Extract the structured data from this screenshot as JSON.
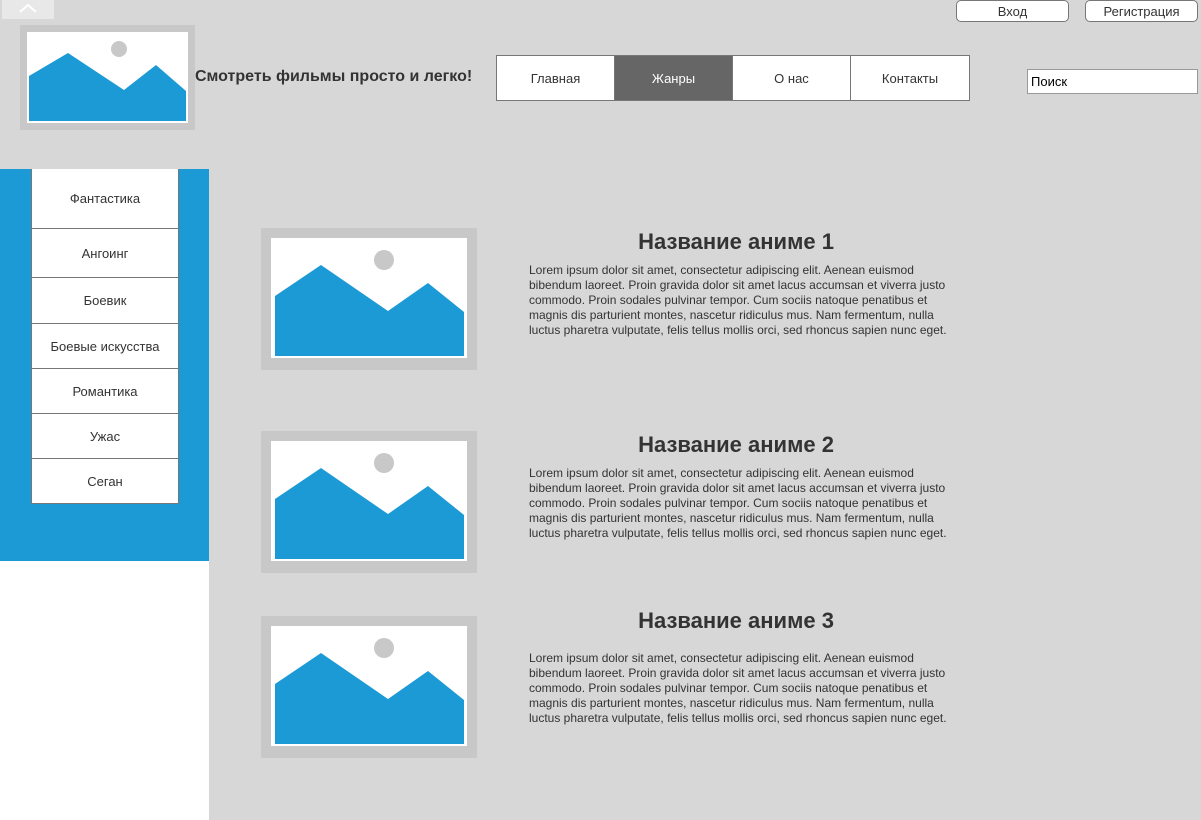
{
  "header": {
    "tagline": "Смотреть фильмы просто и легко!",
    "login_label": "Вход",
    "register_label": "Регистрация",
    "search_placeholder": "Поиск"
  },
  "nav": {
    "items": [
      {
        "label": "Главная",
        "active": false
      },
      {
        "label": "Жанры",
        "active": true
      },
      {
        "label": "О нас",
        "active": false
      },
      {
        "label": "Контакты",
        "active": false
      }
    ]
  },
  "genres": [
    "Фантастика",
    "Ангоинг",
    "Боевик",
    "Боевые искусства",
    "Романтика",
    "Ужас",
    "Сеган"
  ],
  "cards": [
    {
      "title": "Название аниме 1",
      "description": "Lorem ipsum dolor sit amet, consectetur adipiscing elit. Aenean euismod bibendum laoreet. Proin gravida dolor sit amet lacus accumsan et viverra justo commodo. Proin sodales pulvinar tempor. Cum sociis natoque penatibus et magnis dis parturient montes, nascetur ridiculus mus. Nam fermentum, nulla luctus pharetra vulputate, felis tellus mollis orci, sed rhoncus sapien nunc eget."
    },
    {
      "title": "Название аниме 2",
      "description": "Lorem ipsum dolor sit amet, consectetur adipiscing elit. Aenean euismod bibendum laoreet. Proin gravida dolor sit amet lacus accumsan et viverra justo commodo. Proin sodales pulvinar tempor. Cum sociis natoque penatibus et magnis dis parturient montes, nascetur ridiculus mus. Nam fermentum, nulla luctus pharetra vulputate, felis tellus mollis orci, sed rhoncus sapien nunc eget."
    },
    {
      "title": "Название аниме 3",
      "description": "Lorem ipsum dolor sit amet, consectetur adipiscing elit. Aenean euismod bibendum laoreet. Proin gravida dolor sit amet lacus accumsan et viverra justo commodo. Proin sodales pulvinar tempor. Cum sociis natoque penatibus et magnis dis parturient montes, nascetur ridiculus mus. Nam fermentum, nulla luctus pharetra vulputate, felis tellus mollis orci, sed rhoncus sapien nunc eget."
    }
  ],
  "colors": {
    "accent": "#1b9ad6",
    "nav_active": "#666666",
    "background": "#d7d7d7",
    "placeholder_frame": "#c8c8c8"
  },
  "icons": {
    "collapse": "chevron-up-icon",
    "placeholder_image": "image-placeholder-icon"
  }
}
